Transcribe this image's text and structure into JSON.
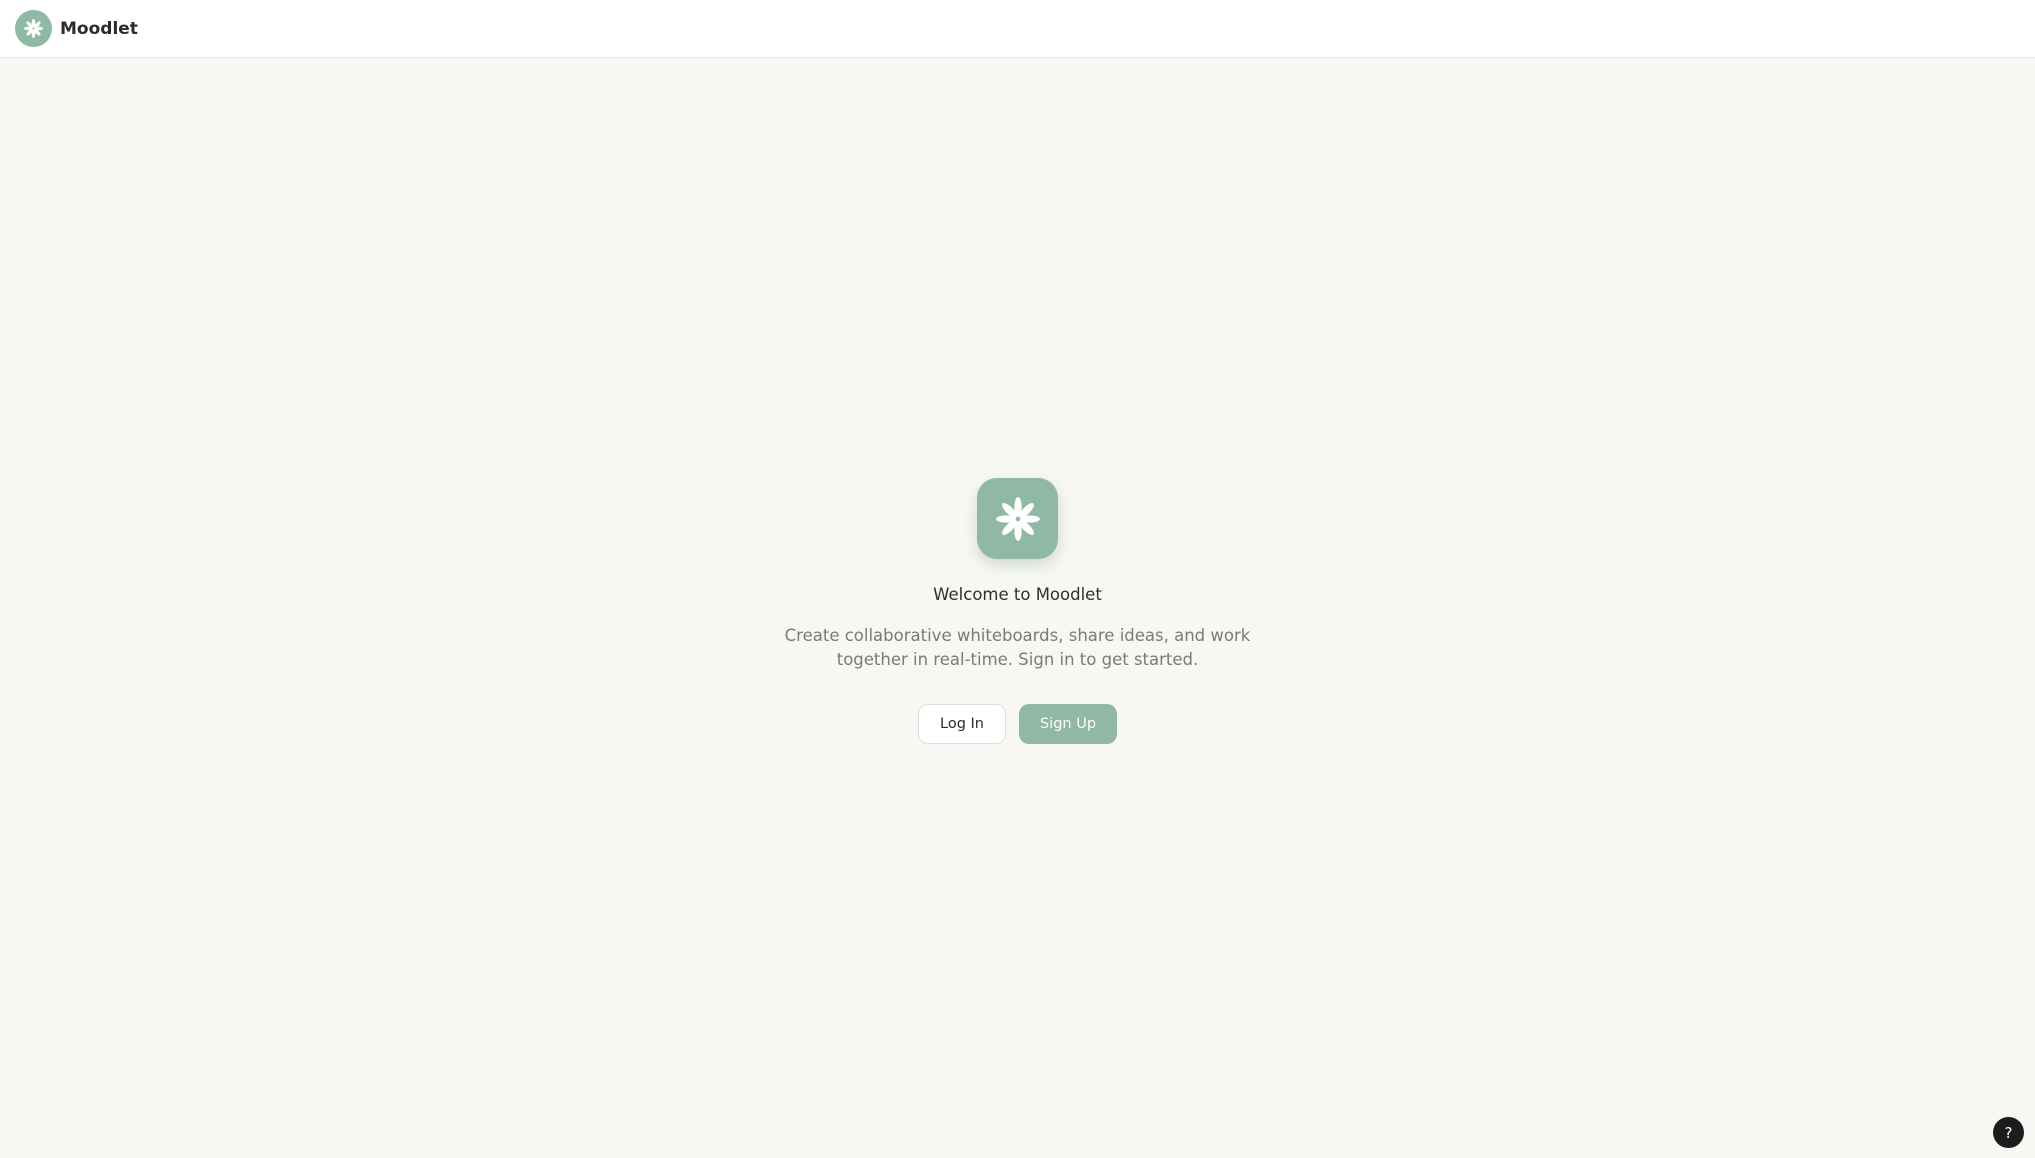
{
  "app": {
    "name": "Moodlet",
    "accent_color": "#8fb8a5",
    "logo_icon": "flower-asterisk-icon"
  },
  "hero": {
    "icon": "flower-asterisk-icon",
    "title": "Welcome to Moodlet",
    "description": "Create collaborative whiteboards, share ideas, and work together in real-time. Sign in to get started."
  },
  "actions": {
    "login_label": "Log In",
    "signup_label": "Sign Up"
  },
  "help": {
    "label": "?",
    "icon": "help-question-icon"
  }
}
